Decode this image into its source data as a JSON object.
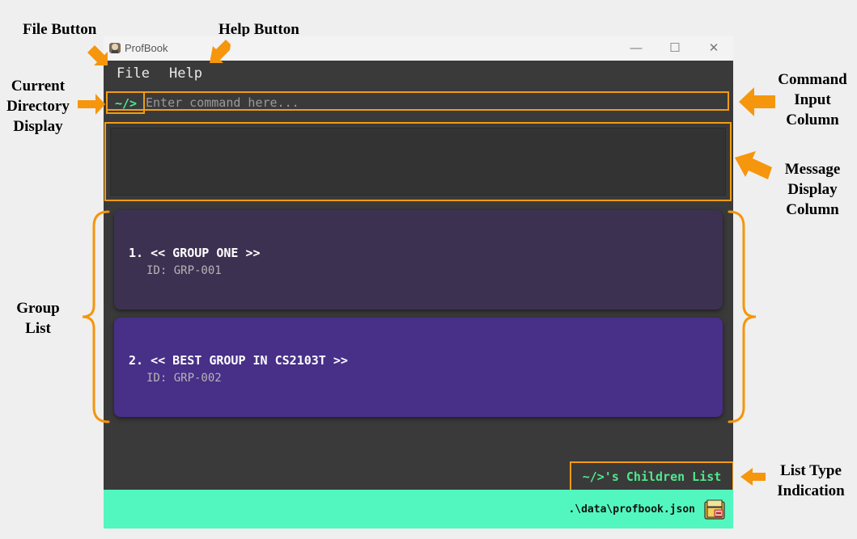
{
  "window": {
    "title": "ProfBook",
    "controls": [
      "—",
      "☐",
      "✕"
    ]
  },
  "menu": {
    "file": "File",
    "help": "Help"
  },
  "command": {
    "directory": "~/>",
    "placeholder": "Enter command here..."
  },
  "groups": [
    {
      "name": "1.  << GROUP ONE >>",
      "id": "ID: GRP-001",
      "color": "#3d3152"
    },
    {
      "name": "2.  << BEST GROUP IN CS2103T >>",
      "id": "ID: GRP-002",
      "color": "#482f88"
    }
  ],
  "list_type": "~/>'s Children List",
  "status": {
    "path": ".\\data\\profbook.json"
  },
  "annotations": {
    "file_button": "File Button",
    "help_button": "Help Button",
    "current_directory": [
      "Current",
      "Directory",
      "Display"
    ],
    "command_input": [
      "Command",
      "Input",
      "Column"
    ],
    "message_display": [
      "Message",
      "Display",
      "Column"
    ],
    "group_list": [
      "Group",
      "List"
    ],
    "list_type": [
      "List Type",
      "Indication"
    ]
  },
  "colors": {
    "accent": "#f39c12",
    "green": "#4ee98d",
    "status_bg": "#52f7c0"
  }
}
